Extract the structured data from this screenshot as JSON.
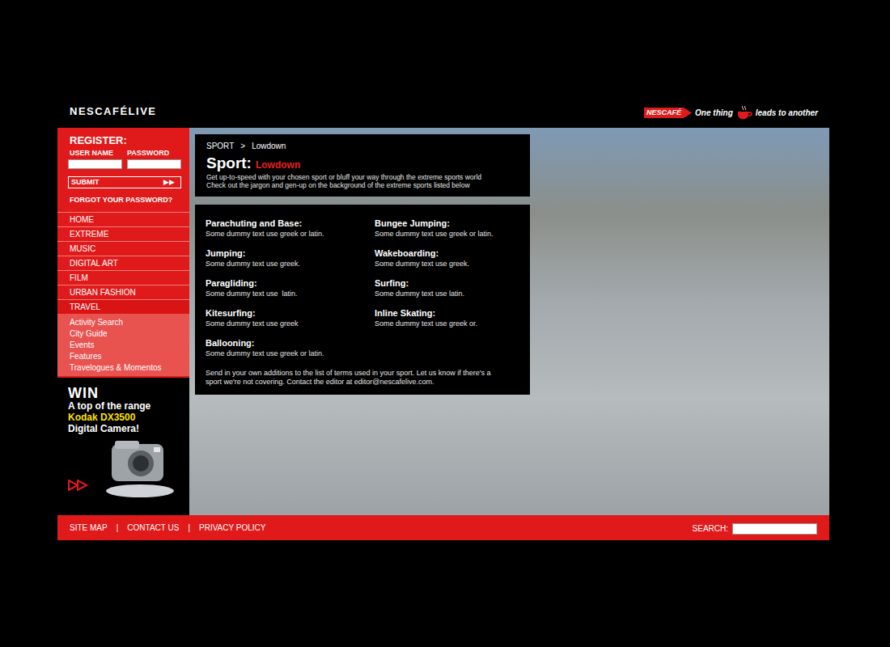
{
  "header": {
    "logo": "NESCAFÉLIVE",
    "brand": "NESCAFÉ",
    "tagline_start": "One thing",
    "tagline_end": "leads to another"
  },
  "register": {
    "title": "REGISTER:",
    "username_label": "USER NAME",
    "password_label": "PASSWORD",
    "submit": "SUBMIT",
    "submit_arrows": "▶▶",
    "forgot": "FORGOT YOUR PASSWORD?"
  },
  "nav": [
    {
      "label": "HOME",
      "expanded": false
    },
    {
      "label": "EXTREME",
      "expanded": false
    },
    {
      "label": "MUSIC",
      "expanded": false
    },
    {
      "label": "DIGITAL ART",
      "expanded": false
    },
    {
      "label": "FILM",
      "expanded": false
    },
    {
      "label": "URBAN FASHION",
      "expanded": false
    },
    {
      "label": "TRAVEL",
      "expanded": true
    }
  ],
  "subnav": [
    "Activity Search",
    "City Guide",
    "Events",
    "Features",
    "Travelogues & Momentos"
  ],
  "promo": {
    "win": "WIN",
    "line1": "A top of the range",
    "product": "Kodak DX3500",
    "line3": "Digital Camera!"
  },
  "breadcrumb": {
    "section": "SPORT",
    "separator": ">",
    "page": "Lowdown"
  },
  "heading": {
    "title": "Sport:",
    "subtitle": "Lowdown"
  },
  "intro": [
    "Get up-to-speed with your chosen sport or bluff your way through the extreme sports world",
    "Check out the jargon and gen-up on the background of the extreme sports listed below"
  ],
  "terms": [
    [
      {
        "name": "Parachuting and Base:",
        "text": "Some dummy text use greek or latin."
      },
      {
        "name": "Jumping:",
        "text": "Some dummy text use greek."
      },
      {
        "name": "Paragliding:",
        "text": "Some dummy text use  latin."
      },
      {
        "name": "Kitesurfing:",
        "text": "Some dummy text use greek"
      },
      {
        "name": "Ballooning:",
        "text": "Some dummy text use greek or latin."
      }
    ],
    [
      {
        "name": "Bungee Jumping:",
        "text": "Some dummy text use greek or latin."
      },
      {
        "name": "Wakeboarding:",
        "text": "Some dummy text use greek."
      },
      {
        "name": "Surfing:",
        "text": "Some dummy text use latin."
      },
      {
        "name": "Inline Skating:",
        "text": "Some dummy text use greek or."
      }
    ]
  ],
  "note": "Send in your own additions to the list of terms used in your sport. Let us know if there's a sport we're not covering. Contact the editor at editor@nescafelive.com.",
  "footer": {
    "links": [
      "SITE MAP",
      "CONTACT US",
      "PRIVACY POLICY"
    ],
    "separator": "|",
    "search_label": "SEARCH:"
  }
}
